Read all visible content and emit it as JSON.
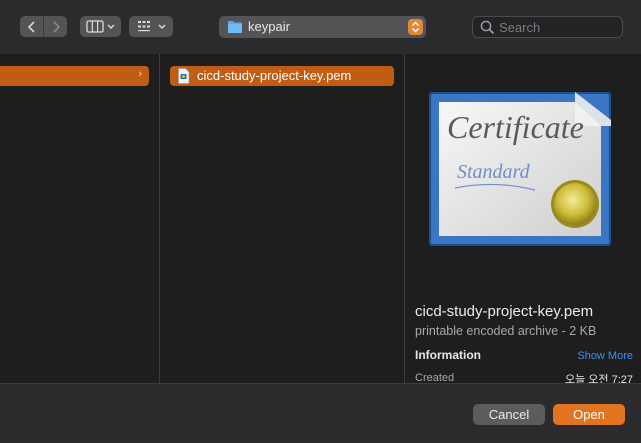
{
  "toolbar": {
    "path_label": "keypair",
    "search_placeholder": "Search"
  },
  "icons": {
    "back": "chevron-left-icon",
    "forward": "chevron-right-icon",
    "columns_view": "columns-view-icon",
    "grid_view": "grid-view-icon",
    "folder": "folder-icon",
    "stepper": "up-down-chevron-icon",
    "search": "search-icon",
    "file": "document-icon",
    "certificate": "certificate-icon"
  },
  "columns": {
    "file_name": "cicd-study-project-key.pem"
  },
  "preview": {
    "file_name": "cicd-study-project-key.pem",
    "kind": "printable encoded archive - 2 KB",
    "information_label": "Information",
    "show_more": "Show More",
    "created_label": "Created",
    "created_value": "오늘 오전 7:27",
    "cert_text_title": "Certificate",
    "cert_text_sub": "Standard"
  },
  "footer": {
    "cancel_label": "Cancel",
    "open_label": "Open"
  },
  "colors": {
    "accent": "#c15c14",
    "primary_button": "#e0741f",
    "link": "#3a8ef0",
    "folder": "#5aa9ea"
  }
}
